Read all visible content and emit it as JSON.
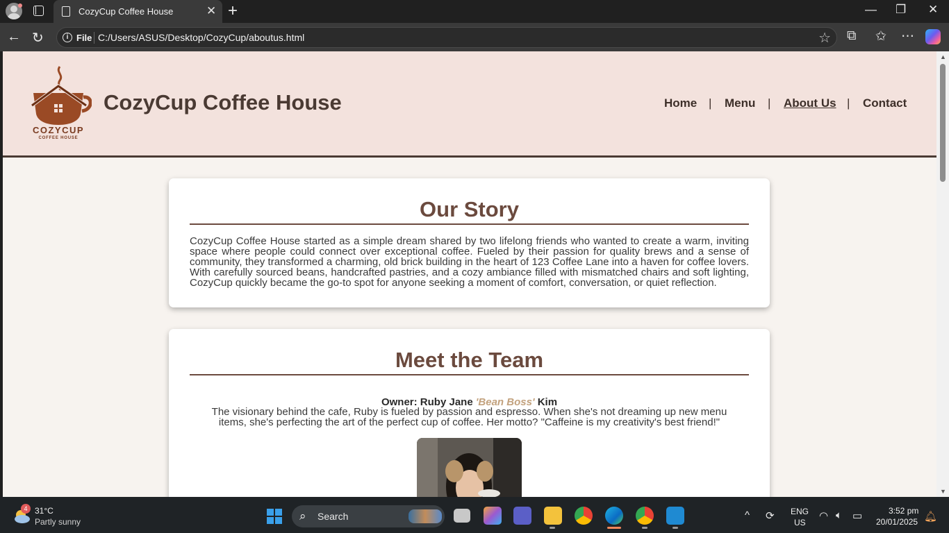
{
  "browser": {
    "tab_title": "CozyCup Coffee House",
    "tab_close": "✕",
    "new_tab": "+",
    "file_label": "File",
    "url": "C:/Users/ASUS/Desktop/CozyCup/aboutus.html",
    "window_controls": [
      "—",
      "❐",
      "✕"
    ]
  },
  "site": {
    "title": "CozyCup Coffee House",
    "logo_name": "COZYCUP",
    "logo_sub": "COFFEE HOUSE",
    "nav": [
      {
        "label": "Home"
      },
      {
        "label": "Menu"
      },
      {
        "label": "About Us",
        "active": true
      },
      {
        "label": "Contact"
      }
    ],
    "nav_separator": "|"
  },
  "story": {
    "heading": "Our Story",
    "body": "CozyCup Coffee House started as a simple dream shared by two lifelong friends who wanted to create a warm, inviting space where people could connect over exceptional coffee. Fueled by their passion for quality brews and a sense of community, they transformed a charming, old brick building in the heart of 123 Coffee Lane into a haven for coffee lovers. With carefully sourced beans, handcrafted pastries, and a cozy ambiance filled with mismatched chairs and soft lighting, CozyCup quickly became the go-to spot for anyone seeking a moment of comfort, conversation, or quiet reflection."
  },
  "team": {
    "heading": "Meet the Team",
    "owner_prefix": "Owner: Ruby Jane",
    "owner_nickname": "'Bean Boss'",
    "owner_suffix": "Kim",
    "owner_description": "The visionary behind the cafe, Ruby is fueled by passion and espresso. When she's not dreaming up new menu items, she's perfecting the art of the perfect cup of coffee. Her motto? \"Caffeine is my creativity's best friend!\""
  },
  "taskbar": {
    "weather_badge": "4",
    "weather_temp": "31°C",
    "weather_desc": "Partly sunny",
    "search_label": "Search",
    "lang_line1": "ENG",
    "lang_line2": "US",
    "time": "3:52 pm",
    "date": "20/01/2025"
  },
  "colors": {
    "header_bg": "#f3e2dd",
    "page_bg": "#f7f3ef",
    "heading": "#6b4a3e",
    "nickname": "#c3a27e",
    "logo": "#9a4a25"
  },
  "icons": [
    "profile-icon",
    "workspaces-icon",
    "page-icon",
    "back-icon",
    "refresh-icon",
    "info-icon",
    "star-icon",
    "extensions-icon",
    "favorites-icon",
    "more-icon",
    "copilot-icon",
    "weather-icon",
    "windows-start-icon",
    "search-icon",
    "wifi-icon",
    "volume-icon",
    "battery-icon",
    "bell-icon"
  ]
}
